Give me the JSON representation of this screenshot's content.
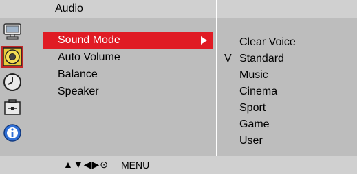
{
  "header": {
    "title": "Audio"
  },
  "sidebar": {
    "icons": [
      {
        "name": "picture-icon",
        "selected": false
      },
      {
        "name": "audio-icon",
        "selected": true
      },
      {
        "name": "time-icon",
        "selected": false
      },
      {
        "name": "option-icon",
        "selected": false
      },
      {
        "name": "information-icon",
        "selected": false
      }
    ]
  },
  "menu": {
    "items": [
      {
        "label": "Sound Mode"
      },
      {
        "label": "Auto Volume"
      },
      {
        "label": "Balance"
      },
      {
        "label": "Speaker"
      }
    ],
    "selected_index": 0
  },
  "submenu": {
    "options": [
      {
        "label": "Clear Voice",
        "check": ""
      },
      {
        "label": "Standard",
        "check": "V"
      },
      {
        "label": "Music",
        "check": ""
      },
      {
        "label": "Cinema",
        "check": ""
      },
      {
        "label": "Sport",
        "check": ""
      },
      {
        "label": "Game",
        "check": ""
      },
      {
        "label": "User",
        "check": ""
      }
    ]
  },
  "footer": {
    "nav_glyphs": "▲▼◀▶⊙",
    "menu_label": "MENU"
  },
  "colors": {
    "highlight": "#e01b24",
    "icon_selected_bg": "#c12626",
    "panel": "#bdbdbd",
    "bar": "#d0d0d0"
  }
}
